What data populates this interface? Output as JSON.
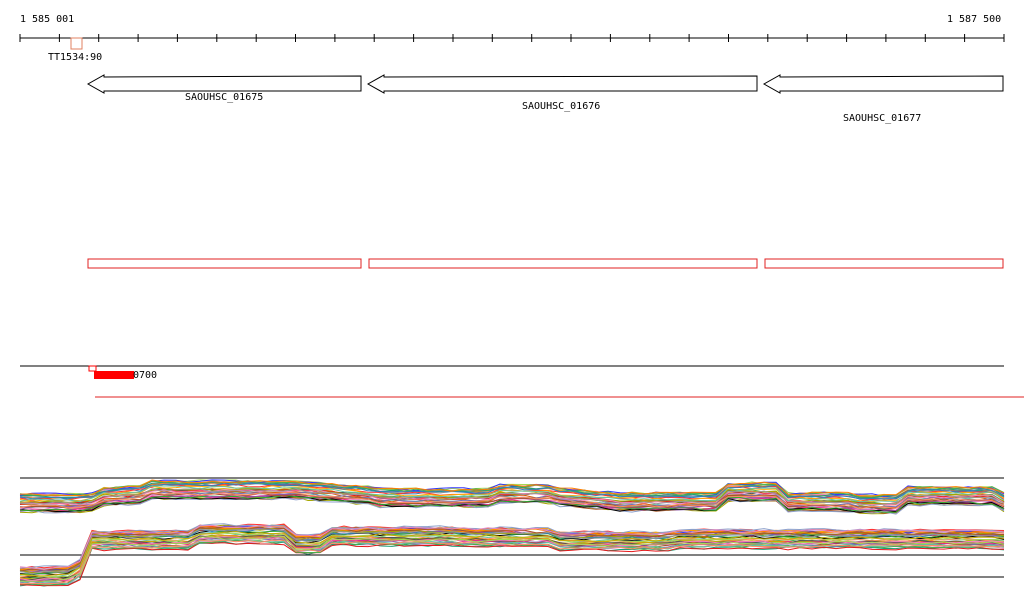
{
  "ruler": {
    "start_label": "1 585 001",
    "end_label": "1 587 500"
  },
  "terminator": {
    "label": "TT1534:90"
  },
  "genes": [
    {
      "label": "SAOUHSC_01675",
      "strand": "-"
    },
    {
      "label": "SAOUHSC_01676",
      "strand": "-"
    },
    {
      "label": "SAOUHSC_01677",
      "strand": "-"
    }
  ],
  "feature_track": {
    "label": "0700"
  },
  "colors": {
    "gene_outline": "#000000",
    "region_outline": "#e02020",
    "feature_fill": "#ff0000",
    "terminator_outline": "#e08060"
  }
}
